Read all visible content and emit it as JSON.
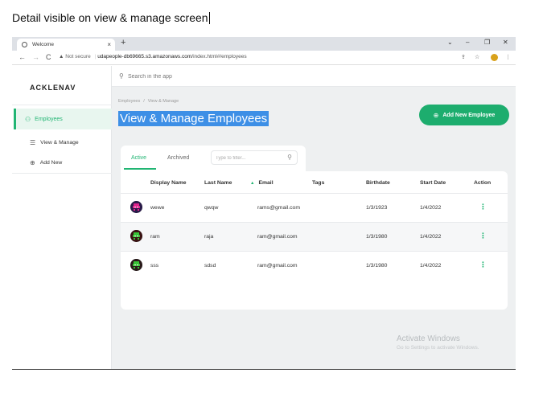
{
  "caption": "Detail visible on view & manage screen",
  "browser": {
    "tab_title": "Welcome",
    "tab_close": "×",
    "new_tab": "+",
    "window_controls": {
      "dropdown": "⌄",
      "minimize": "–",
      "restore": "❐",
      "close": "✕"
    },
    "nav": {
      "back": "←",
      "forward": "→",
      "reload": "C"
    },
    "security_label": "Not secure",
    "url_domain": "udapeople-db69665.s3.amazonaws.com",
    "url_path": "/index.html#/employees"
  },
  "app": {
    "logo": "ACKLENAV",
    "search_placeholder": "Search in the app",
    "sidebar": {
      "primary": "Employees",
      "items": [
        "View & Manage",
        "Add New"
      ]
    },
    "breadcrumb": [
      "Employees",
      "/",
      "View & Manage"
    ],
    "page_title": "View & Manage Employees",
    "add_button": "Add New Employee",
    "tabs": [
      "Active",
      "Archived"
    ],
    "filter_placeholder": "Type to filter...",
    "table": {
      "headers": [
        "Display Name",
        "Last Name",
        "Email",
        "Tags",
        "Birthdate",
        "Start Date",
        "Action"
      ],
      "sort_indicator": "▲",
      "rows": [
        {
          "display_name": "wewe",
          "last_name": "qwqw",
          "email": "rams@gmail.com",
          "tags": "",
          "birthdate": "1/3/1923",
          "start_date": "1/4/2022"
        },
        {
          "display_name": "ram",
          "last_name": "raja",
          "email": "ram@gmail.com",
          "tags": "",
          "birthdate": "1/3/1980",
          "start_date": "1/4/2022"
        },
        {
          "display_name": "sss",
          "last_name": "sdsd",
          "email": "ram@gmail.com",
          "tags": "",
          "birthdate": "1/3/1980",
          "start_date": "1/4/2022"
        }
      ]
    }
  },
  "watermark": {
    "line1": "Activate Windows",
    "line2": "Go to Settings to activate Windows."
  },
  "colors": {
    "accent": "#21b573",
    "button": "#1dad6e",
    "highlight": "#3d8fe6"
  },
  "icons": [
    "globe-icon",
    "warning-icon",
    "search-icon",
    "person-icon",
    "list-icon",
    "plus-circle-icon",
    "kebab-icon",
    "avatar-icon"
  ]
}
